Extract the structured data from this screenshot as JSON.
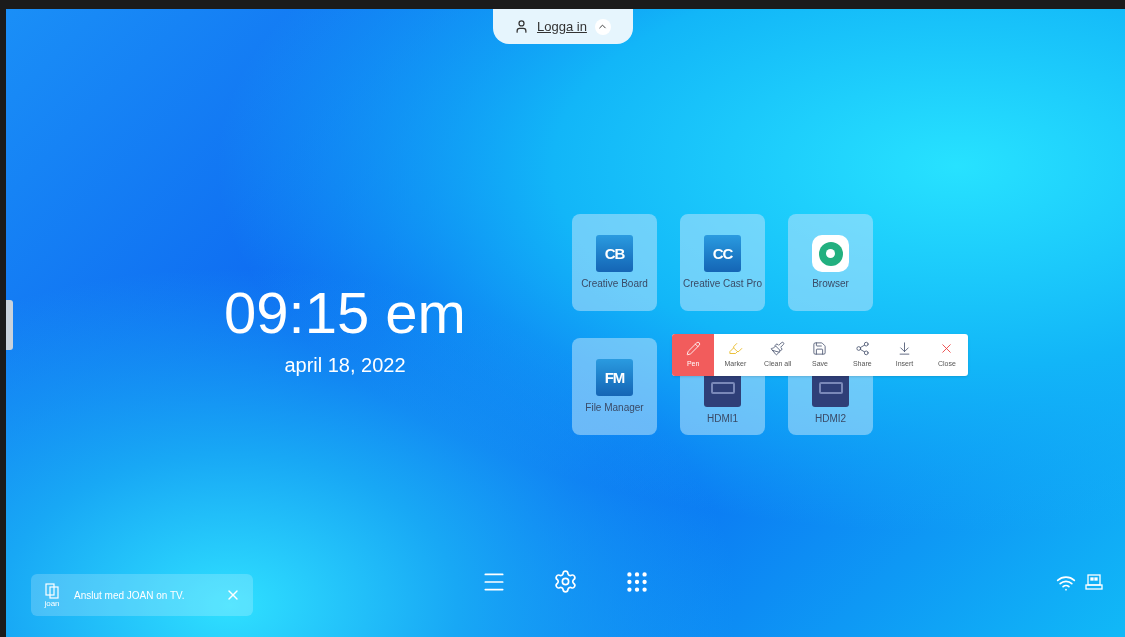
{
  "login": {
    "label": "Logga in",
    "expanded": true
  },
  "clock": {
    "time": "09:15 em",
    "date": "april 18, 2022"
  },
  "apps": [
    {
      "kind": "cb",
      "icon_text": "CB",
      "label": "Creative Board"
    },
    {
      "kind": "cc",
      "icon_text": "CC",
      "label": "Creative Cast Pro"
    },
    {
      "kind": "browser",
      "label": "Browser"
    },
    {
      "kind": "fm",
      "icon_text": "FM",
      "label": "File Manager"
    },
    {
      "kind": "hdmi",
      "label": "HDMI1"
    },
    {
      "kind": "hdmi",
      "label": "HDMI2"
    }
  ],
  "toolbar": [
    {
      "kind": "pen",
      "label": "Pen",
      "selected": true
    },
    {
      "kind": "marker",
      "label": "Marker",
      "selected": false
    },
    {
      "kind": "clean",
      "label": "Clean all",
      "selected": false
    },
    {
      "kind": "save",
      "label": "Save",
      "selected": false
    },
    {
      "kind": "share",
      "label": "Share",
      "selected": false
    },
    {
      "kind": "insert",
      "label": "Insert",
      "selected": false
    },
    {
      "kind": "close",
      "label": "Close",
      "selected": false
    }
  ],
  "toast": {
    "logo_text": "joan",
    "message": "Anslut med JOAN on TV."
  }
}
